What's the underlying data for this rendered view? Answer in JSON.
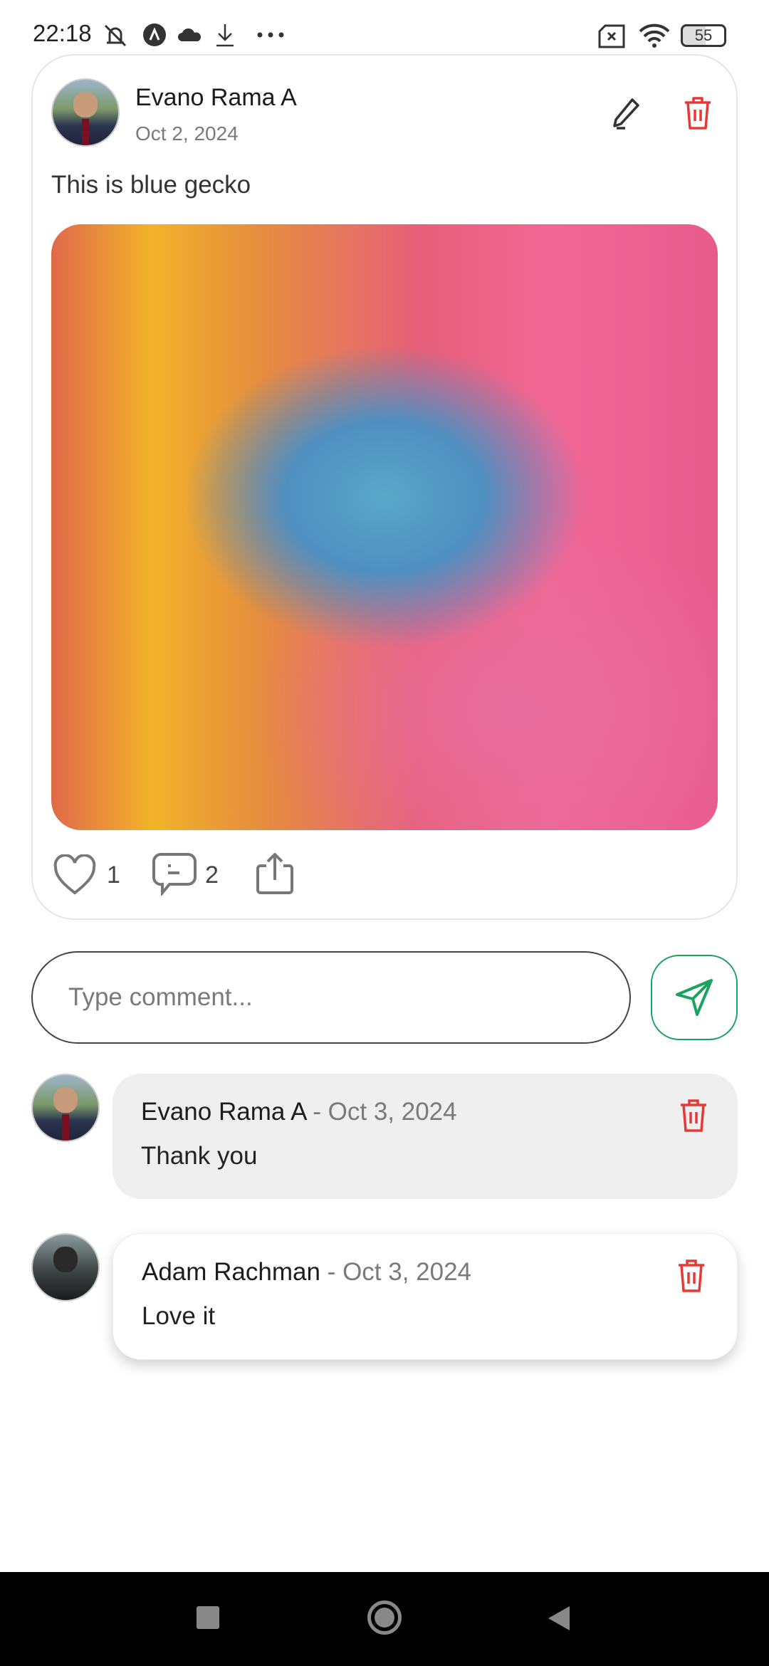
{
  "status_bar": {
    "time": "22:18",
    "battery": "55"
  },
  "post": {
    "author": "Evano Rama A",
    "date": "Oct 2, 2024",
    "text": "This is blue gecko",
    "likes": "1",
    "comments": "2"
  },
  "comment_input": {
    "placeholder": "Type comment..."
  },
  "comments": [
    {
      "author": "Evano Rama A",
      "separator": " - ",
      "date": "Oct 3, 2024",
      "text": "Thank you"
    },
    {
      "author": "Adam Rachman",
      "separator": " - ",
      "date": "Oct 3, 2024",
      "text": "Love it"
    }
  ],
  "colors": {
    "accent": "#1aa260",
    "danger": "#e53935"
  }
}
